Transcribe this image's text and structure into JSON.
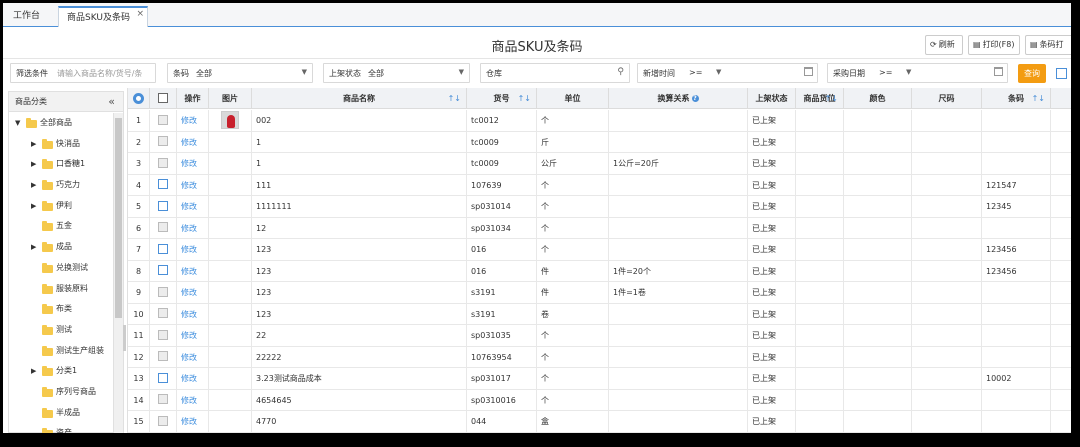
{
  "tabs": {
    "home": "工作台",
    "active": "商品SKU及条码",
    "close": "×"
  },
  "title": "商品SKU及条码",
  "toolbar": {
    "refresh": "刷新",
    "print": "打印(F8)",
    "barcode": "条码打"
  },
  "filters": {
    "filter_label": "筛选条件",
    "filter_placeholder": "请输入商品名称/货号/条",
    "barcode_label": "条码",
    "barcode_value": "全部",
    "status_label": "上架状态",
    "status_value": "全部",
    "warehouse_label": "仓库",
    "added_time_label": "新增时间",
    "added_time_op": ">=",
    "purchase_date_label": "采购日期",
    "purchase_date_op": ">=",
    "query": "查询"
  },
  "sidebar": {
    "title": "商品分类",
    "items": [
      {
        "label": "全部商品",
        "level": 0,
        "arrow": "▼"
      },
      {
        "label": "快消品",
        "level": 1,
        "arrow": "▶"
      },
      {
        "label": "口香糖1",
        "level": 1,
        "arrow": "▶"
      },
      {
        "label": "巧克力",
        "level": 1,
        "arrow": "▶"
      },
      {
        "label": "伊利",
        "level": 1,
        "arrow": "▶"
      },
      {
        "label": "五金",
        "level": 1,
        "arrow": ""
      },
      {
        "label": "成品",
        "level": 1,
        "arrow": "▶"
      },
      {
        "label": "兑换测试",
        "level": 1,
        "arrow": ""
      },
      {
        "label": "服装原料",
        "level": 1,
        "arrow": ""
      },
      {
        "label": "布类",
        "level": 1,
        "arrow": ""
      },
      {
        "label": "测试",
        "level": 1,
        "arrow": ""
      },
      {
        "label": "测试生产组装",
        "level": 1,
        "arrow": ""
      },
      {
        "label": "分类1",
        "level": 1,
        "arrow": "▶"
      },
      {
        "label": "序列号商品",
        "level": 1,
        "arrow": ""
      },
      {
        "label": "半成品",
        "level": 1,
        "arrow": ""
      },
      {
        "label": "资产",
        "level": 1,
        "arrow": ""
      }
    ]
  },
  "grid": {
    "headers": {
      "op": "操作",
      "img": "图片",
      "name": "商品名称",
      "code": "货号",
      "unit": "单位",
      "conv": "换算关系",
      "status": "上架状态",
      "loc": "商品货位",
      "color": "颜色",
      "size": "尺码",
      "barcode": "条码"
    },
    "sort_icon": "↑↓",
    "rows": [
      {
        "n": "1",
        "op": "修改",
        "name": "002",
        "code": "tc0012",
        "unit": "个",
        "conv": "",
        "status": "已上架",
        "barcode": "",
        "checked": false,
        "img": true
      },
      {
        "n": "2",
        "op": "修改",
        "name": "1",
        "code": "tc0009",
        "unit": "斤",
        "conv": "",
        "status": "已上架",
        "barcode": "",
        "checked": false,
        "img": false
      },
      {
        "n": "3",
        "op": "修改",
        "name": "1",
        "code": "tc0009",
        "unit": "公斤",
        "conv": "1公斤=20斤",
        "status": "已上架",
        "barcode": "",
        "checked": false,
        "img": false
      },
      {
        "n": "4",
        "op": "修改",
        "name": "111",
        "code": "107639",
        "unit": "个",
        "conv": "",
        "status": "已上架",
        "barcode": "121547",
        "checked": true,
        "img": false
      },
      {
        "n": "5",
        "op": "修改",
        "name": "1111111",
        "code": "sp031014",
        "unit": "个",
        "conv": "",
        "status": "已上架",
        "barcode": "12345",
        "checked": true,
        "img": false
      },
      {
        "n": "6",
        "op": "修改",
        "name": "12",
        "code": "sp031034",
        "unit": "个",
        "conv": "",
        "status": "已上架",
        "barcode": "",
        "checked": false,
        "img": false
      },
      {
        "n": "7",
        "op": "修改",
        "name": "123",
        "code": "016",
        "unit": "个",
        "conv": "",
        "status": "已上架",
        "barcode": "123456",
        "checked": true,
        "img": false
      },
      {
        "n": "8",
        "op": "修改",
        "name": "123",
        "code": "016",
        "unit": "件",
        "conv": "1件=20个",
        "status": "已上架",
        "barcode": "123456",
        "checked": true,
        "img": false
      },
      {
        "n": "9",
        "op": "修改",
        "name": "123",
        "code": "s3191",
        "unit": "件",
        "conv": "1件=1卷",
        "status": "已上架",
        "barcode": "",
        "checked": false,
        "img": false
      },
      {
        "n": "10",
        "op": "修改",
        "name": "123",
        "code": "s3191",
        "unit": "卷",
        "conv": "",
        "status": "已上架",
        "barcode": "",
        "checked": false,
        "img": false
      },
      {
        "n": "11",
        "op": "修改",
        "name": "22",
        "code": "sp031035",
        "unit": "个",
        "conv": "",
        "status": "已上架",
        "barcode": "",
        "checked": false,
        "img": false
      },
      {
        "n": "12",
        "op": "修改",
        "name": "22222",
        "code": "10763954",
        "unit": "个",
        "conv": "",
        "status": "已上架",
        "barcode": "",
        "checked": false,
        "img": false
      },
      {
        "n": "13",
        "op": "修改",
        "name": "3.23测试商品成本",
        "code": "sp031017",
        "unit": "个",
        "conv": "",
        "status": "已上架",
        "barcode": "10002",
        "checked": true,
        "img": false
      },
      {
        "n": "14",
        "op": "修改",
        "name": "4654645",
        "code": "sp0310016",
        "unit": "个",
        "conv": "",
        "status": "已上架",
        "barcode": "",
        "checked": false,
        "img": false
      },
      {
        "n": "15",
        "op": "修改",
        "name": "4770",
        "code": "044",
        "unit": "盒",
        "conv": "",
        "status": "已上架",
        "barcode": "",
        "checked": false,
        "img": false
      }
    ]
  }
}
